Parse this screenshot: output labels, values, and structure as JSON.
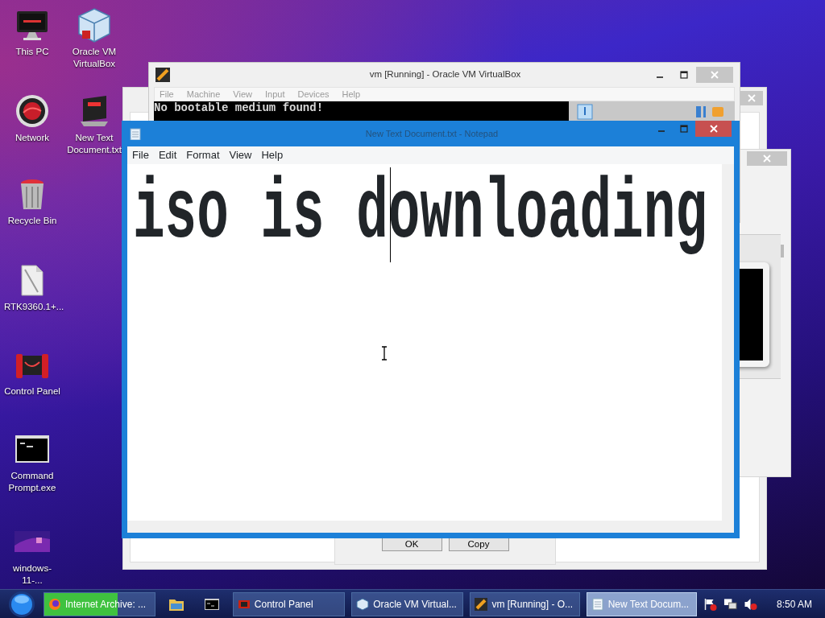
{
  "desktop_icons": [
    {
      "label": "This PC"
    },
    {
      "label": "Oracle VM VirtualBox"
    },
    {
      "label": "Network"
    },
    {
      "label": "New Text Document.txt"
    },
    {
      "label": "Recycle Bin"
    },
    {
      "label": "RTK9360.1+..."
    },
    {
      "label": "Control Panel"
    },
    {
      "label": "Command Prompt.exe"
    },
    {
      "label": "windows-11-..."
    }
  ],
  "dialog": {
    "buttons": [
      "OK",
      "Copy"
    ]
  },
  "virtualbox_window": {
    "title": "vm [Running] - Oracle VM VirtualBox",
    "menu": [
      "File",
      "Machine",
      "View",
      "Input",
      "Devices",
      "Help"
    ],
    "screen_lines": [
      "No bootable medium found!"
    ]
  },
  "notepad": {
    "title": "New Text Document.txt - Notepad",
    "menu": [
      "File",
      "Edit",
      "Format",
      "View",
      "Help"
    ],
    "content": "iso is downloading"
  },
  "taskbar": {
    "buttons": [
      {
        "label": "Internet Archive: ...",
        "selected": false,
        "level": 0.66
      },
      {
        "label": "Control Panel",
        "selected": false
      },
      {
        "label": "Oracle VM Virtual...",
        "selected": false
      },
      {
        "label": "vm [Running] - O...",
        "selected": false
      },
      {
        "label": "New Text Docum...",
        "selected": true
      }
    ],
    "clock": "8:50 AM"
  }
}
